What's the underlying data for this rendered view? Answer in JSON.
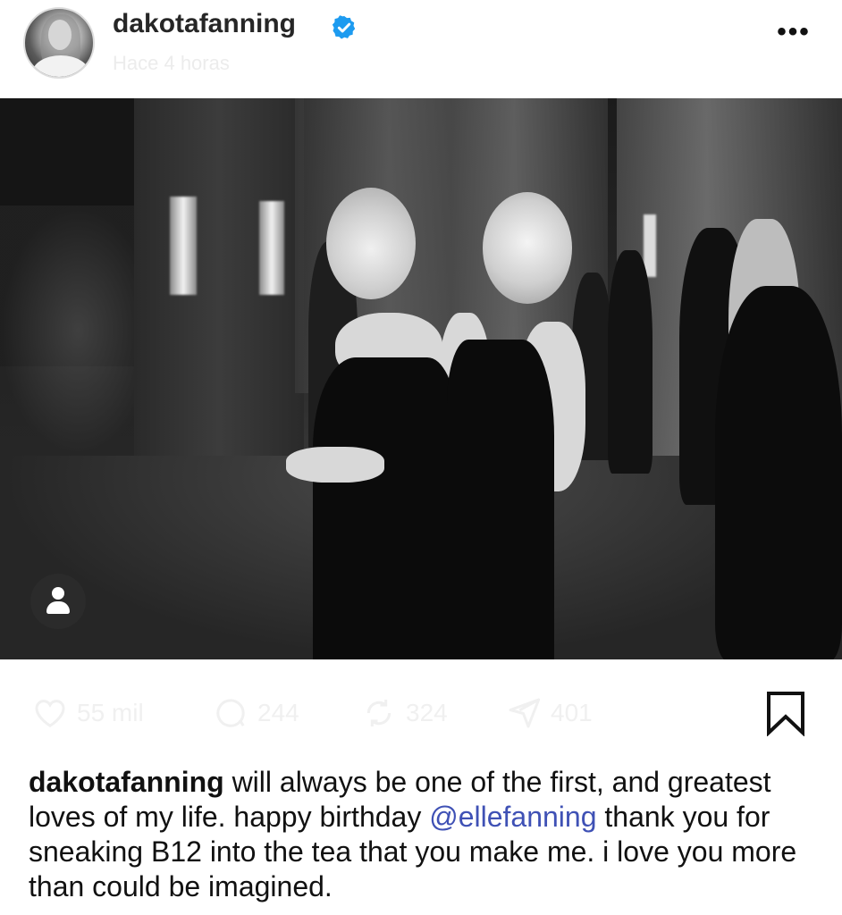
{
  "header": {
    "username": "dakotafanning",
    "timestamp": "Hace 4 horas",
    "more_label": "•••"
  },
  "actions": {
    "likes": "55 mil",
    "comments": "244",
    "reposts": "324",
    "shares": "401"
  },
  "caption": {
    "username": "dakotafanning",
    "text_before": " will always be one of the first, and greatest loves of my life. happy birthday ",
    "mention": "@ellefanning",
    "text_after": " thank you for sneaking B12 into the tea that you make me. i love you more than could be imagined."
  },
  "colors": {
    "verified": "#1d9bf0",
    "mention": "#3f51b5",
    "faded_text": "#ececec"
  },
  "icons": [
    "verified-icon",
    "more-icon",
    "tag-person-icon",
    "heart-icon",
    "comment-icon",
    "repost-icon",
    "share-icon",
    "bookmark-icon"
  ]
}
